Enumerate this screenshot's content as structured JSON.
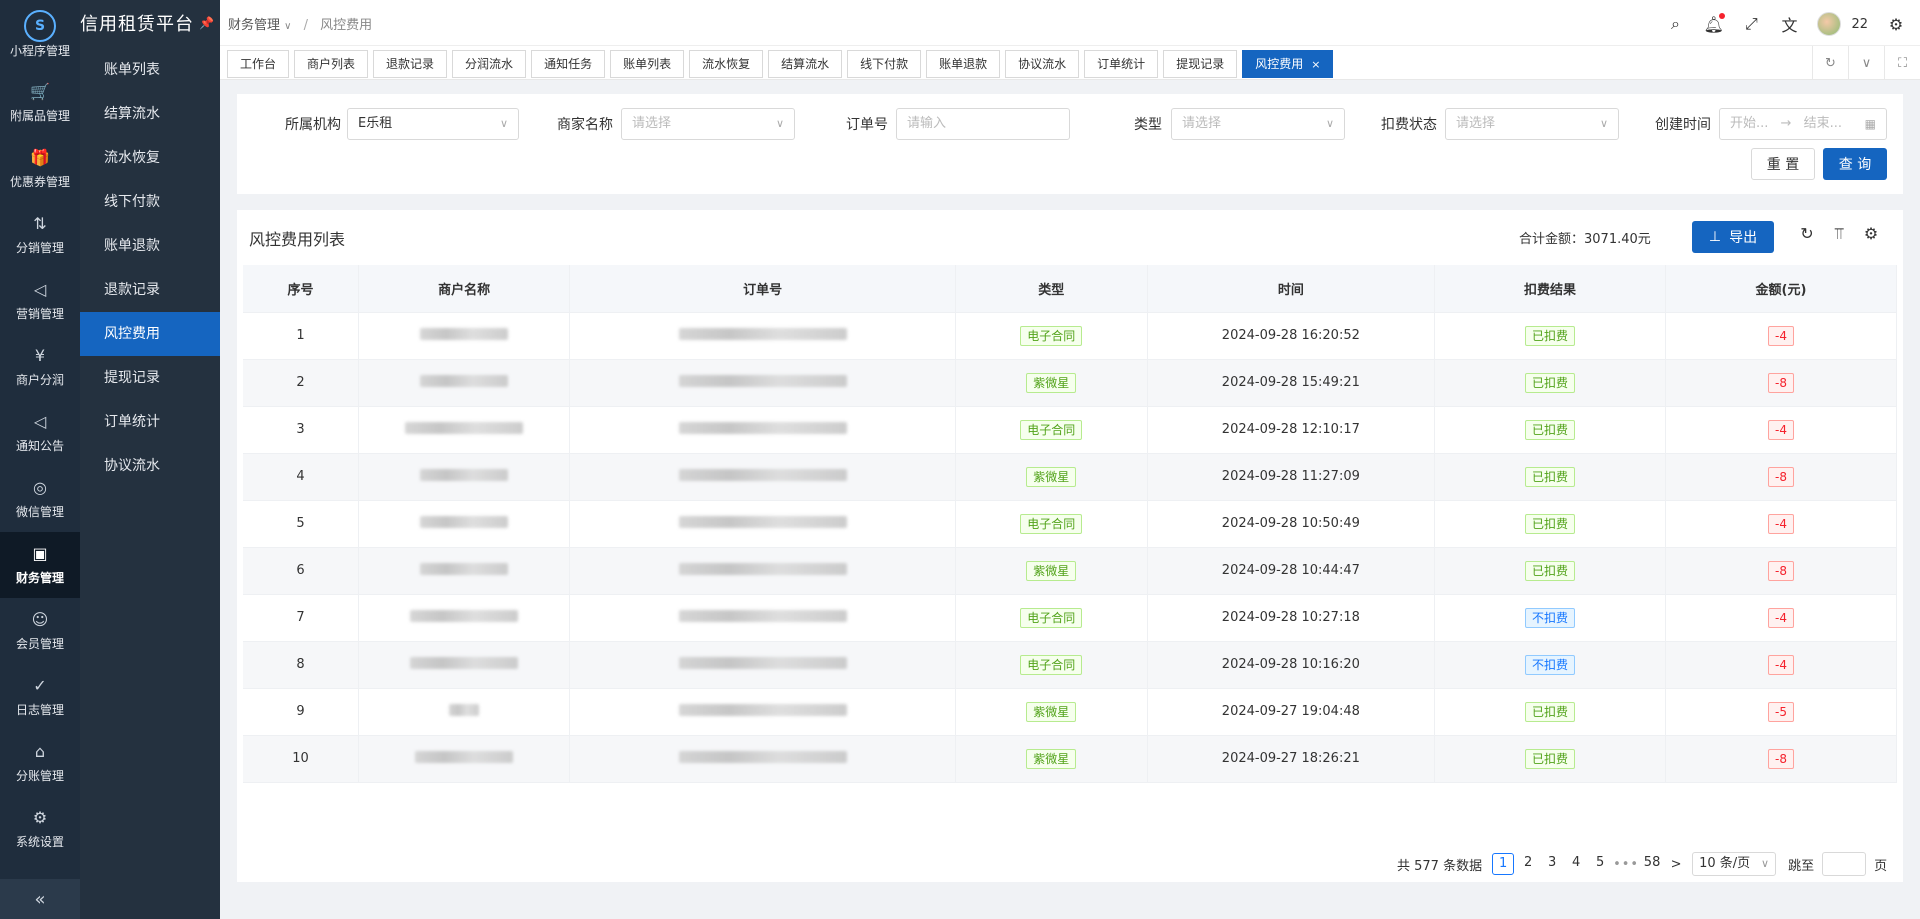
{
  "app": {
    "title": "信用租赁平台"
  },
  "rail": {
    "items": [
      {
        "label": "小程序管理",
        "icon": "mini-program-icon",
        "glyph": ""
      },
      {
        "label": "附属品管理",
        "icon": "cart-icon",
        "glyph": "🛒"
      },
      {
        "label": "优惠券管理",
        "icon": "gift-icon",
        "glyph": "🎁"
      },
      {
        "label": "分销管理",
        "icon": "distribution-icon",
        "glyph": "⇅"
      },
      {
        "label": "营销管理",
        "icon": "megaphone-icon",
        "glyph": "◁"
      },
      {
        "label": "商户分润",
        "icon": "yen-icon",
        "glyph": "¥"
      },
      {
        "label": "通知公告",
        "icon": "notice-icon",
        "glyph": "◁"
      },
      {
        "label": "微信管理",
        "icon": "wechat-icon",
        "glyph": "◎"
      },
      {
        "label": "财务管理",
        "icon": "finance-icon",
        "glyph": "▣"
      },
      {
        "label": "会员管理",
        "icon": "member-icon",
        "glyph": "☺"
      },
      {
        "label": "日志管理",
        "icon": "log-shield-icon",
        "glyph": "✓"
      },
      {
        "label": "分账管理",
        "icon": "split-icon",
        "glyph": "⌂"
      },
      {
        "label": "系统设置",
        "icon": "settings-icon",
        "glyph": "⚙"
      }
    ],
    "collapse_glyph": "«"
  },
  "submenu": {
    "items": [
      "账单列表",
      "结算流水",
      "流水恢复",
      "线下付款",
      "账单退款",
      "退款记录",
      "风控费用",
      "提现记录",
      "订单统计",
      "协议流水"
    ]
  },
  "header": {
    "breadcrumb_parent": "财务管理",
    "breadcrumb_current": "风控费用",
    "user_count": "22"
  },
  "tabs": [
    "工作台",
    "商户列表",
    "退款记录",
    "分润流水",
    "通知任务",
    "账单列表",
    "流水恢复",
    "结算流水",
    "线下付款",
    "账单退款",
    "协议流水",
    "订单统计",
    "提现记录",
    "风控费用"
  ],
  "filters": {
    "org_label": "所属机构",
    "org_value": "E乐租",
    "merchant_label": "商家名称",
    "merchant_placeholder": "请选择",
    "order_label": "订单号",
    "order_placeholder": "请输入",
    "type_label": "类型",
    "type_placeholder": "请选择",
    "status_label": "扣费状态",
    "status_placeholder": "请选择",
    "time_label": "创建时间",
    "time_start": "开始...",
    "time_end": "结束...",
    "reset": "重 置",
    "query": "查 询"
  },
  "list": {
    "title": "风控费用列表",
    "total": "合计金额：3071.40元",
    "export": "导出",
    "columns": [
      "序号",
      "商户名称",
      "订单号",
      "类型",
      "时间",
      "扣费结果",
      "金额(元)"
    ],
    "rows": [
      {
        "no": "1",
        "type": "电子合同",
        "time": "2024-09-28 16:20:52",
        "result": "已扣费",
        "amount": "-4"
      },
      {
        "no": "2",
        "type": "紫微星",
        "time": "2024-09-28 15:49:21",
        "result": "已扣费",
        "amount": "-8"
      },
      {
        "no": "3",
        "type": "电子合同",
        "time": "2024-09-28 12:10:17",
        "result": "已扣费",
        "amount": "-4"
      },
      {
        "no": "4",
        "type": "紫微星",
        "time": "2024-09-28 11:27:09",
        "result": "已扣费",
        "amount": "-8"
      },
      {
        "no": "5",
        "type": "电子合同",
        "time": "2024-09-28 10:50:49",
        "result": "已扣费",
        "amount": "-4"
      },
      {
        "no": "6",
        "type": "紫微星",
        "time": "2024-09-28 10:44:47",
        "result": "已扣费",
        "amount": "-8"
      },
      {
        "no": "7",
        "type": "电子合同",
        "time": "2024-09-28 10:27:18",
        "result": "不扣费",
        "amount": "-4"
      },
      {
        "no": "8",
        "type": "电子合同",
        "time": "2024-09-28 10:16:20",
        "result": "不扣费",
        "amount": "-4"
      },
      {
        "no": "9",
        "type": "紫微星",
        "time": "2024-09-27 19:04:48",
        "result": "已扣费",
        "amount": "-5"
      },
      {
        "no": "10",
        "type": "紫微星",
        "time": "2024-09-27 18:26:21",
        "result": "已扣费",
        "amount": "-8"
      }
    ]
  },
  "pagination": {
    "total": "共 577 条数据",
    "pages": [
      "1",
      "2",
      "3",
      "4",
      "5"
    ],
    "dots": "•••",
    "last": "58",
    "next": ">",
    "page_size": "10 条/页",
    "jump_label": "跳至",
    "page_suffix": "页"
  },
  "colors": {
    "primary": "#1565c0",
    "sidebar": "#1f2d3d",
    "tag_green": "#52a31a",
    "tag_blue": "#1677ff",
    "tag_red": "#f5222d"
  }
}
